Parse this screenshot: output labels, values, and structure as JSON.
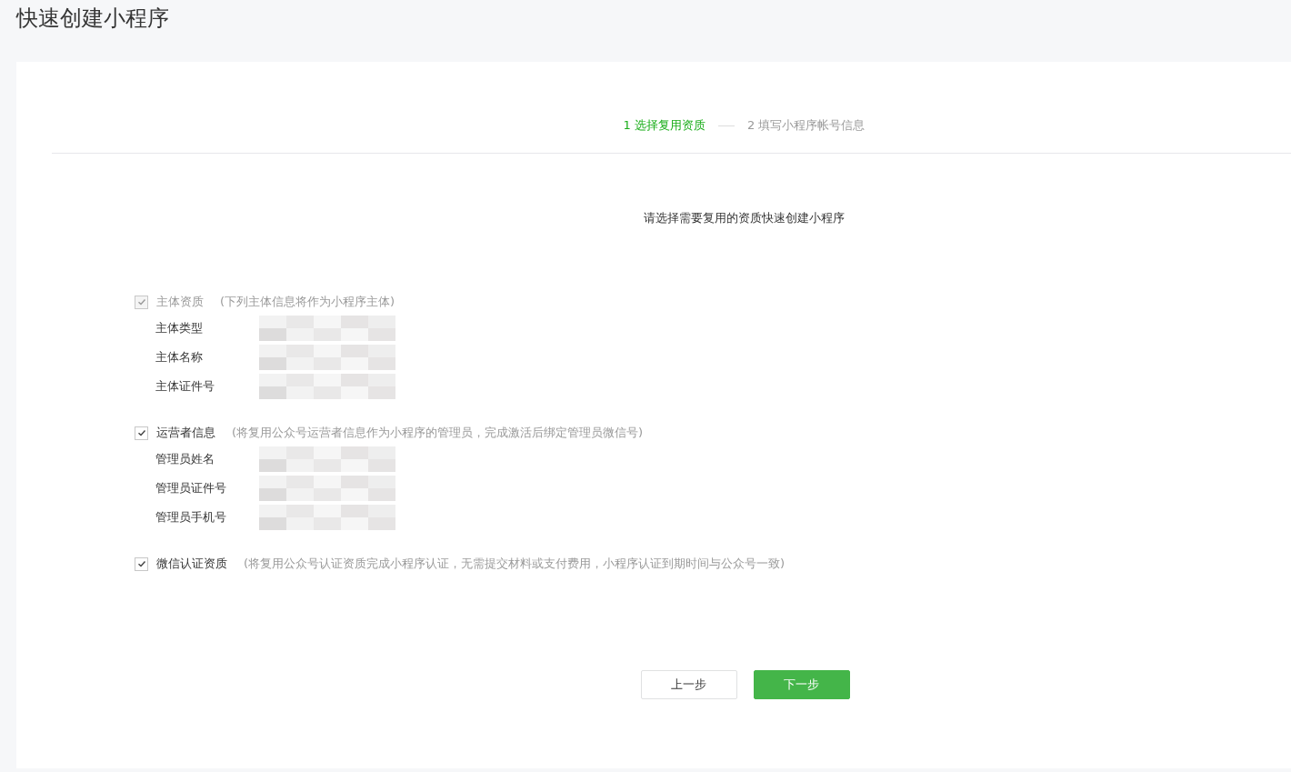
{
  "page_title": "快速创建小程序",
  "steps": [
    {
      "label": "1 选择复用资质",
      "selected": true
    },
    {
      "label": "2 填写小程序帐号信息",
      "selected": false
    }
  ],
  "instruction": "请选择需要复用的资质快速创建小程序",
  "sections": [
    {
      "label": "主体资质",
      "note": "(下列主体信息将作为小程序主体)",
      "checked": true,
      "disabled": true,
      "fields": [
        {
          "label": "主体类型",
          "redacted": true
        },
        {
          "label": "主体名称",
          "redacted": true
        },
        {
          "label": "主体证件号",
          "redacted": true
        }
      ]
    },
    {
      "label": "运营者信息",
      "note": "(将复用公众号运营者信息作为小程序的管理员，完成激活后绑定管理员微信号)",
      "checked": true,
      "disabled": false,
      "fields": [
        {
          "label": "管理员姓名",
          "redacted": true
        },
        {
          "label": "管理员证件号",
          "redacted": true
        },
        {
          "label": "管理员手机号",
          "redacted": true
        }
      ]
    },
    {
      "label": "微信认证资质",
      "note": "(将复用公众号认证资质完成小程序认证，无需提交材料或支付费用，小程序认证到期时间与公众号一致)",
      "checked": true,
      "disabled": false
    }
  ],
  "buttons": [
    {
      "label": "上一步",
      "kind": "secondary"
    },
    {
      "label": "下一步",
      "kind": "primary"
    }
  ]
}
